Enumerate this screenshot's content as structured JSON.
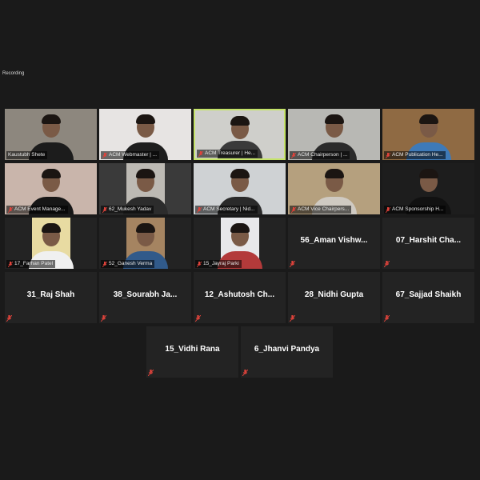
{
  "meeting": {
    "recording_label": "Recording"
  },
  "colors": {
    "active_speaker_border": "#c5e36a",
    "mute_icon": "#e0433b",
    "tile_bg": "#232323",
    "page_bg": "#1a1a1a"
  },
  "icons": {
    "mute": "mic-muted-icon"
  },
  "video_tiles": [
    {
      "name": "Kaustubh Shete",
      "bg": "#8d877e",
      "shirt": "#1c1c1c"
    },
    {
      "name": "ACM Webmaster | ...",
      "bg": "#e7e4e3",
      "shirt": "#1e1e1e"
    },
    {
      "name": "ACM Treasurer | He...",
      "bg": "#cfcfcb",
      "shirt": "#3a3a3a"
    },
    {
      "name": "ACM Chairperson | ...",
      "bg": "#b8b8b4",
      "shirt": "#2b2b2b"
    },
    {
      "name": "ACM Publication He...",
      "bg": "#8f6a43",
      "shirt": "#3e7ab8"
    },
    {
      "name": "ACM Event Manage...",
      "bg": "#c9b5ab",
      "shirt": "#161616"
    },
    {
      "name": "62_Mukesh Yadav",
      "bg": "#bdbab4",
      "shirt": "#2c2c2c"
    },
    {
      "name": "ACM Secretary | Nid...",
      "bg": "#cfd2d4",
      "shirt": "#2a2a2a"
    },
    {
      "name": "ACM Vice Chairpers...",
      "bg": "#b5a07e",
      "shirt": "#cfcac2"
    },
    {
      "name": "ACM Sponsorship H...",
      "bg": "#1d1d1d",
      "shirt": "#111111"
    },
    {
      "name": "17_Farhan Patel",
      "bg": "#e8dba2",
      "shirt": "#f0f0f0"
    },
    {
      "name": "52_Ganesh Verma",
      "bg": "#a58461",
      "shirt": "#315a8a"
    },
    {
      "name": "15_Jayraj Parki",
      "bg": "#e8e8ea",
      "shirt": "#b33a3a"
    }
  ],
  "name_tiles": [
    "56_Aman  Vishw...",
    "07_Harshit  Cha...",
    "31_Raj Shah",
    "38_Sourabh  Ja...",
    "12_Ashutosh  Ch...",
    "28_Nidhi Gupta",
    "67_Sajjad Shaikh",
    "15_Vidhi Rana",
    "6_Jhanvi Pandya"
  ]
}
